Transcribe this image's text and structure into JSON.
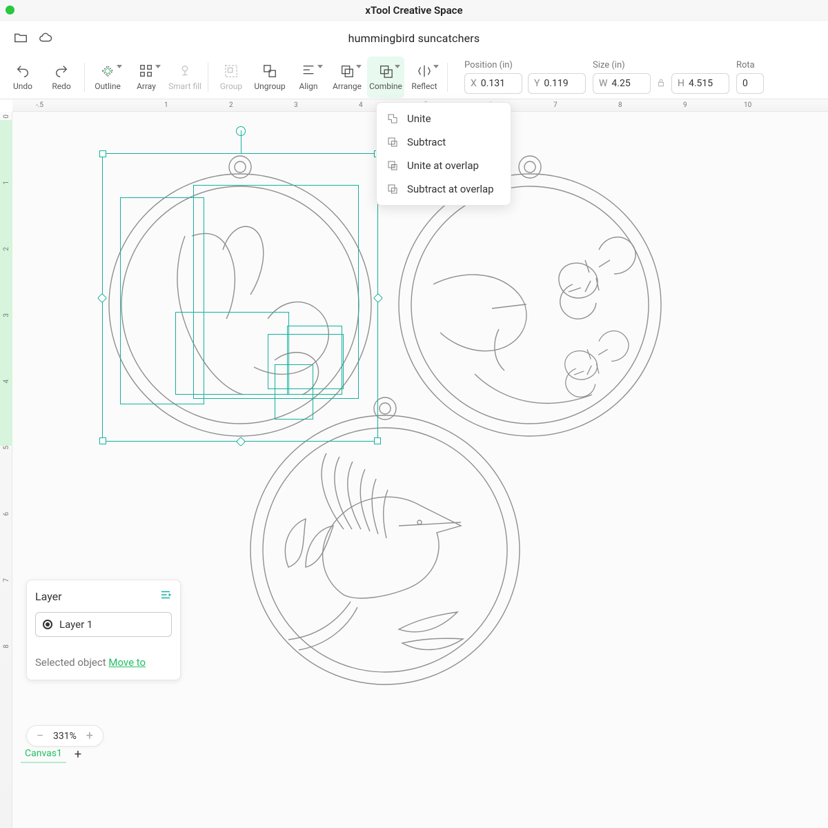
{
  "app": {
    "title": "xTool Creative Space"
  },
  "doc": {
    "title": "hummingbird suncatchers"
  },
  "toolbar": {
    "undo": "Undo",
    "redo": "Redo",
    "outline": "Outline",
    "array": "Array",
    "smartfill": "Smart fill",
    "group": "Group",
    "ungroup": "Ungroup",
    "align": "Align",
    "arrange": "Arrange",
    "combine": "Combine",
    "reflect": "Reflect"
  },
  "props": {
    "position_label": "Position (in)",
    "size_label": "Size (in)",
    "rota_label": "Rota",
    "x_prefix": "X",
    "y_prefix": "Y",
    "w_prefix": "W",
    "h_prefix": "H",
    "x": "0.131",
    "y": "0.119",
    "w": "4.25",
    "h": "4.515",
    "rota": "0"
  },
  "combine_menu": {
    "unite": "Unite",
    "subtract": "Subtract",
    "unite_overlap": "Unite at overlap",
    "subtract_overlap": "Subtract at overlap"
  },
  "ruler": {
    "h": [
      "-.5",
      "1",
      "2",
      "3",
      "4",
      "5",
      "6",
      "7",
      "8",
      "9",
      "10"
    ],
    "v": [
      "0",
      "1",
      "2",
      "3",
      "4",
      "5",
      "6",
      "7",
      "8"
    ]
  },
  "layer": {
    "title": "Layer",
    "name": "Layer 1",
    "selected": "Selected object",
    "moveto": "Move to"
  },
  "zoom": {
    "value": "331%"
  },
  "tabs": {
    "canvas1": "Canvas1"
  }
}
